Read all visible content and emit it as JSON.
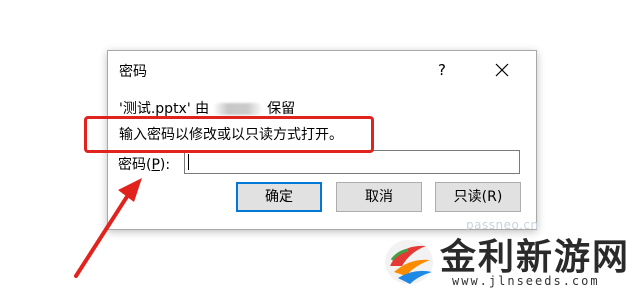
{
  "dialog": {
    "title": "密码",
    "help_label": "?",
    "close_label": "✕",
    "owner_prefix": "'测试.pptx' 由",
    "owner_suffix": "保留",
    "instruction": "输入密码以修改或以只读方式打开。",
    "password_label_pre": "密码(",
    "password_label_key": "P",
    "password_label_post": "):",
    "password_value": "",
    "buttons": {
      "ok": "确定",
      "cancel": "取消",
      "readonly": "只读(R)"
    }
  },
  "annotation": {
    "color": "#e0241d"
  },
  "watermark": {
    "top_text": "passneo.cn",
    "title": "金利新游网",
    "url": "www.jlnseeds.com"
  },
  "colors": {
    "accent": "#0078d7",
    "button_bg": "#e1e1e1",
    "annotation_red": "#e0241d"
  }
}
